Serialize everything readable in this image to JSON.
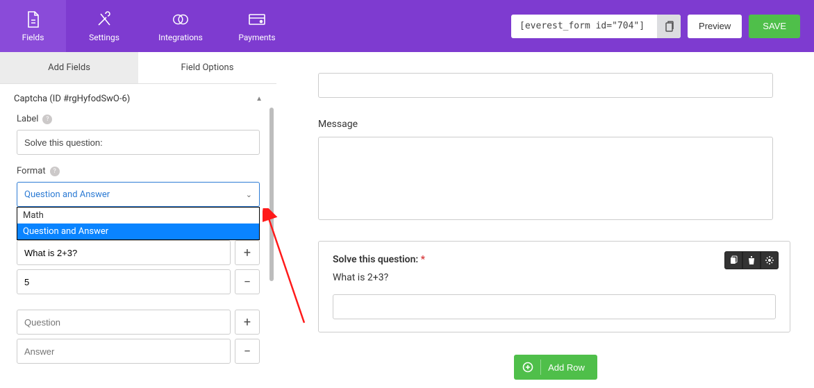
{
  "topbar": {
    "items": [
      {
        "label": "Fields"
      },
      {
        "label": "Settings"
      },
      {
        "label": "Integrations"
      },
      {
        "label": "Payments"
      }
    ],
    "shortcode": "[everest_form id=\"704\"]",
    "preview": "Preview",
    "save": "SAVE"
  },
  "sidebar": {
    "tabs": {
      "add": "Add Fields",
      "options": "Field Options"
    },
    "section_title": "Captcha (ID #rgHyfodSwO-6)",
    "label_field": {
      "label": "Label",
      "value": "Solve this question:"
    },
    "format_field": {
      "label": "Format",
      "selected": "Question and Answer",
      "options": [
        "Math",
        "Question and Answer"
      ]
    },
    "qa1": {
      "question": "What is 2+3?",
      "answer": "5"
    },
    "qa2": {
      "question_ph": "Question",
      "answer_ph": "Answer"
    }
  },
  "canvas": {
    "message_label": "Message",
    "captcha": {
      "title": "Solve this question:",
      "question": "What is 2+3?"
    },
    "add_row": "Add Row"
  }
}
